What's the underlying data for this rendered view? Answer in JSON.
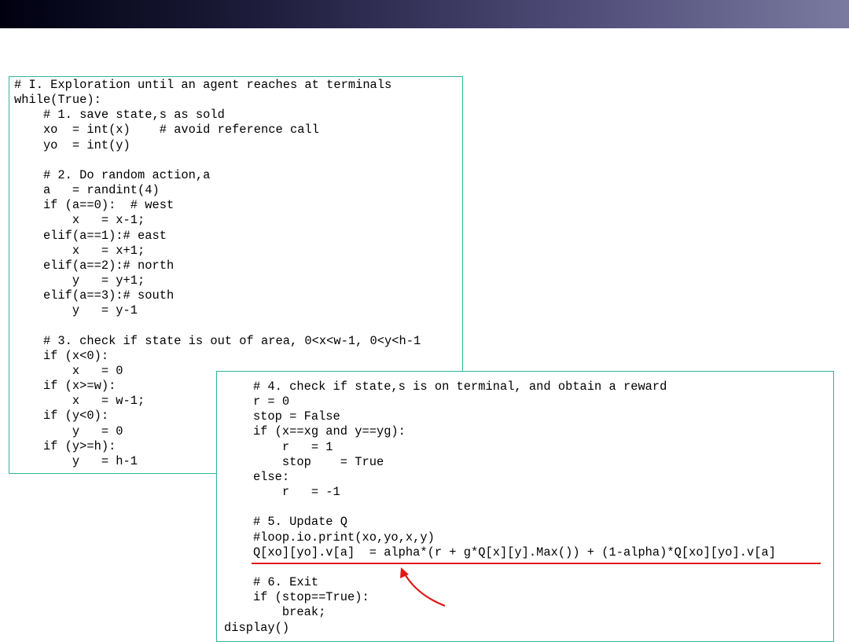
{
  "slide": {
    "code_block_1": {
      "text": "# I. Exploration until an agent reaches at terminals\nwhile(True):\n    # 1. save state,s as sold\n    xo  = int(x)    # avoid reference call\n    yo  = int(y)\n\n    # 2. Do random action,a\n    a   = randint(4)\n    if (a==0):  # west\n        x   = x-1;\n    elif(a==1):# east\n        x   = x+1;\n    elif(a==2):# north\n        y   = y+1;\n    elif(a==3):# south\n        y   = y-1\n\n    # 3. check if state is out of area, 0<x<w-1, 0<y<h-1\n    if (x<0):\n        x   = 0\n    if (x>=w):\n        x   = w-1;\n    if (y<0):\n        y   = 0\n    if (y>=h):\n        y   = h-1"
    },
    "code_block_2": {
      "text": "    # 4. check if state,s is on terminal, and obtain a reward\n    r = 0\n    stop = False\n    if (x==xg and y==yg):\n        r   = 1\n        stop    = True\n    else:\n        r   = -1\n\n    # 5. Update Q\n    #loop.io.print(xo,yo,x,y)\n    Q[xo][yo].v[a]  = alpha*(r + g*Q[x][y].Max()) + (1-alpha)*Q[xo][yo].v[a]\n\n    # 6. Exit\n    if (stop==True):\n        break;\ndisplay()"
    },
    "annotation_color": "#e01818",
    "header_colors": [
      "#000010",
      "#7a7aa0"
    ]
  }
}
